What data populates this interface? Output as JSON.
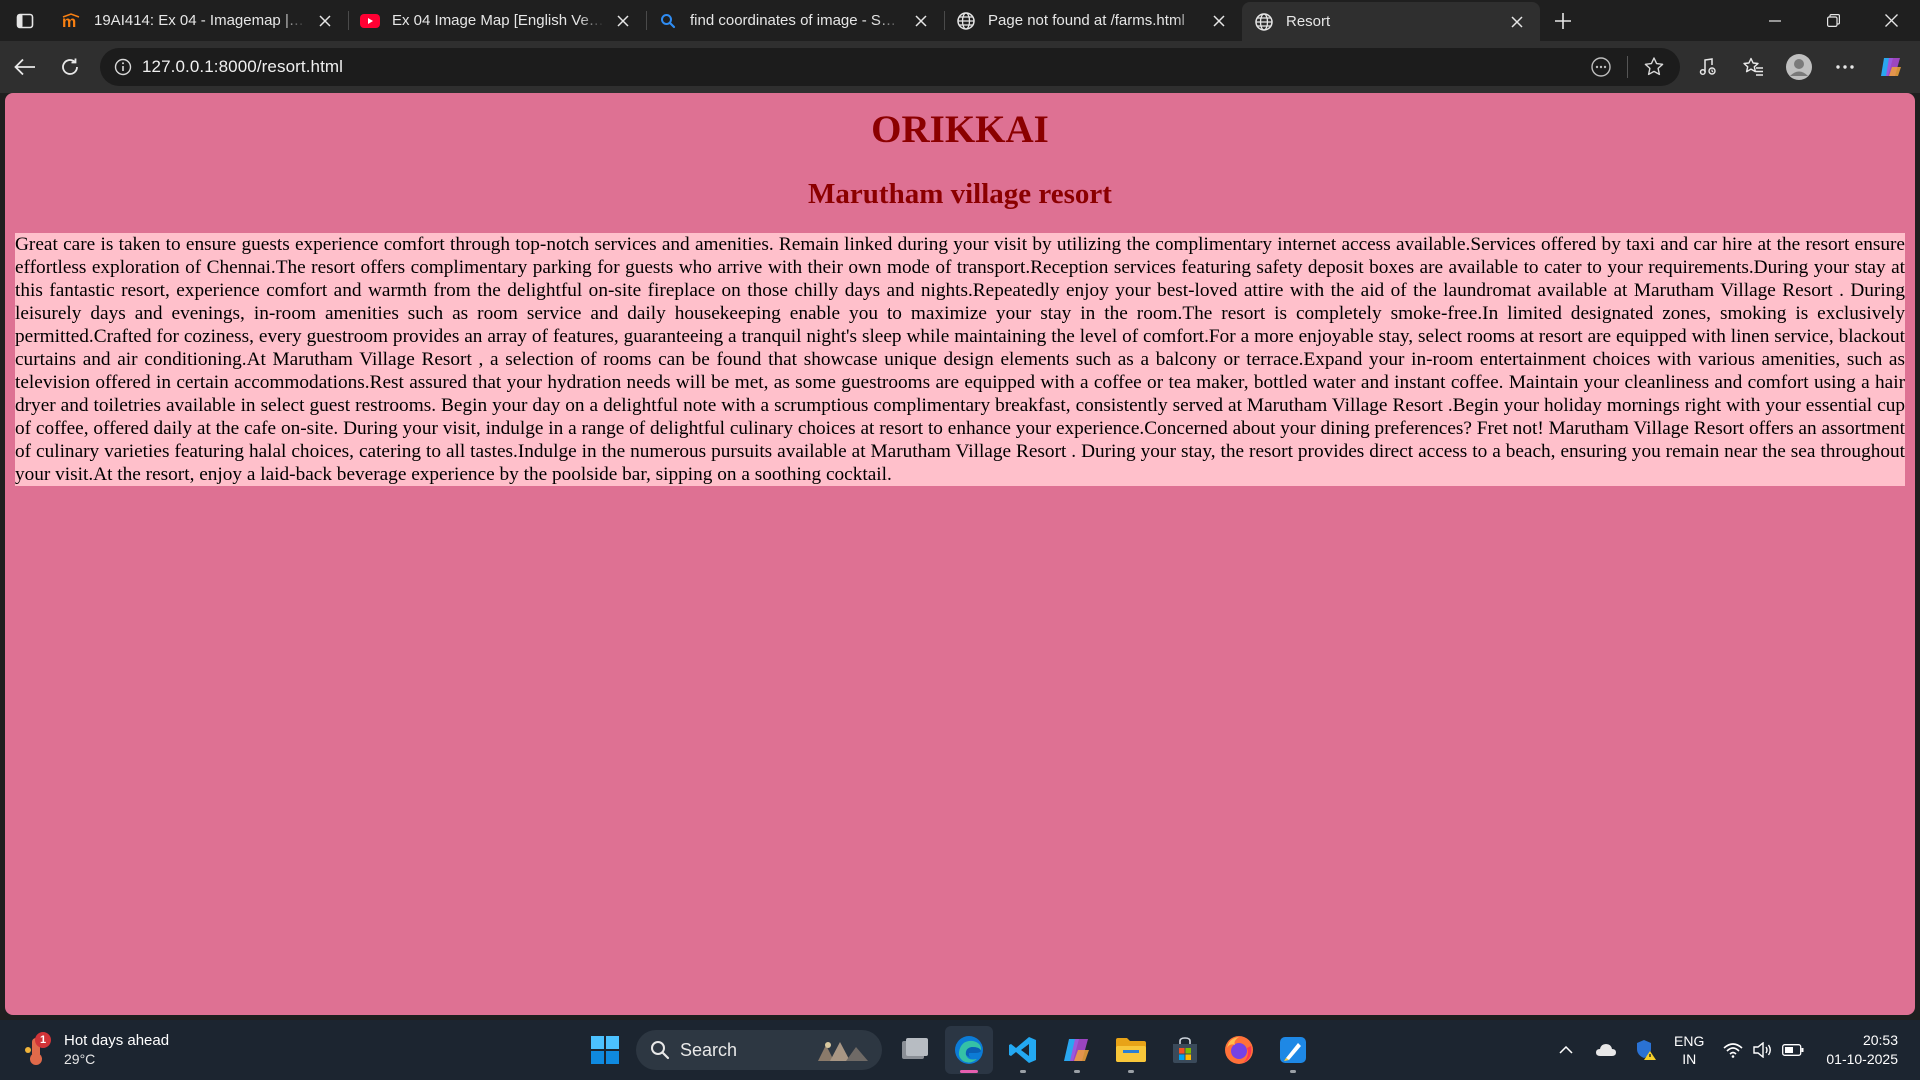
{
  "browser": {
    "tabs": [
      {
        "title": "19AI414: Ex 04 - Imagemap | SEC",
        "icon": "moodle-favicon",
        "active": false
      },
      {
        "title": "Ex 04 Image Map [English Version]",
        "icon": "youtube-favicon",
        "active": false
      },
      {
        "title": "find coordinates of image - Search",
        "icon": "search-favicon",
        "active": false
      },
      {
        "title": "Page not found at /farms.html",
        "icon": "globe-favicon",
        "active": false
      },
      {
        "title": "Resort",
        "icon": "globe-favicon",
        "active": true
      }
    ],
    "address": {
      "url": "127.0.0.1:8000/resort.html"
    }
  },
  "page": {
    "heading": "ORIKKAI",
    "subheading": "Marutham village resort",
    "paragraph": "Great care is taken to ensure guests experience comfort through top-notch services and amenities. Remain linked during your visit by utilizing the complimentary internet access available.Services offered by taxi and car hire at the resort ensure effortless exploration of Chennai.The resort offers complimentary parking for guests who arrive with their own mode of transport.Reception services featuring safety deposit boxes are available to cater to your requirements.During your stay at this fantastic resort, experience comfort and warmth from the delightful on-site fireplace on those chilly days and nights.Repeatedly enjoy your best-loved attire with the aid of the laundromat available at Marutham Village Resort . During leisurely days and evenings, in-room amenities such as room service and daily housekeeping enable you to maximize your stay in the room.The resort is completely smoke-free.In limited designated zones, smoking is exclusively permitted.Crafted for coziness, every guestroom provides an array of features, guaranteeing a tranquil night's sleep while maintaining the level of comfort.For a more enjoyable stay, select rooms at resort are equipped with linen service, blackout curtains and air conditioning.At Marutham Village Resort , a selection of rooms can be found that showcase unique design elements such as a balcony or terrace.Expand your in-room entertainment choices with various amenities, such as television offered in certain accommodations.Rest assured that your hydration needs will be met, as some guestrooms are equipped with a coffee or tea maker, bottled water and instant coffee. Maintain your cleanliness and comfort using a hair dryer and toiletries available in select guest restrooms. Begin your day on a delightful note with a scrumptious complimentary breakfast, consistently served at Marutham Village Resort .Begin your holiday mornings right with your essential cup of coffee, offered daily at the cafe on-site. During your visit, indulge in a range of delightful culinary choices at resort to enhance your experience.Concerned about your dining preferences? Fret not! Marutham Village Resort offers an assortment of culinary varieties featuring halal choices, catering to all tastes.Indulge in the numerous pursuits available at Marutham Village Resort . During your stay, the resort provides direct access to a beach, ensuring you remain near the sea throughout your visit.At the resort, enjoy a laid-back beverage experience by the poolside bar, sipping on a soothing cocktail.",
    "colors": {
      "background": "#de7193",
      "heading": "#8b0000",
      "paragraph_bg": "#ffc0cb"
    }
  },
  "taskbar": {
    "weather": {
      "title": "Hot days ahead",
      "temp": "29°C",
      "badge": "1"
    },
    "search_label": "Search",
    "apps": [
      "task-view",
      "edge",
      "vscode",
      "copilot",
      "file-explorer",
      "microsoft-store",
      "firefox",
      "paint"
    ],
    "language": {
      "line1": "ENG",
      "line2": "IN"
    },
    "clock": {
      "time": "20:53",
      "date": "01-10-2025"
    }
  }
}
